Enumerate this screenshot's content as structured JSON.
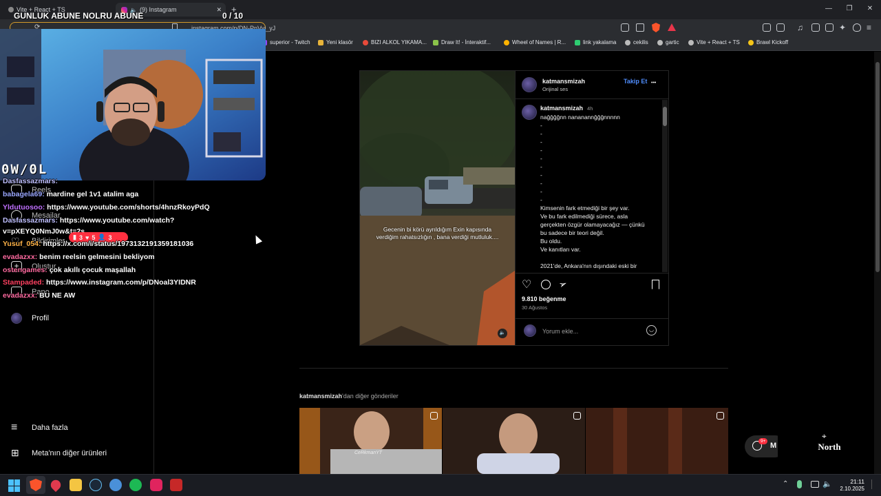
{
  "browser": {
    "tabs": [
      {
        "label": "Vite + React + TS"
      },
      {
        "label": "(9) Instagram"
      }
    ],
    "new_tab": "+",
    "url": "instagram.com/p/DN-PnVyj_yJ",
    "window_controls": [
      "—",
      "❐",
      "✕"
    ],
    "bookmarks": [
      {
        "label": "superior - Twitch",
        "color": "#9146ff"
      },
      {
        "label": "Yeni klasör",
        "color": "#e8b43a"
      },
      {
        "label": "BIZI ALKOL YIKAMA...",
        "color": "#e84a3a"
      },
      {
        "label": "Draw It! - İnteraktif...",
        "color": "#8bc34a"
      },
      {
        "label": "Wheel of Names | R...",
        "color": "#ffb300"
      },
      {
        "label": "link yakalama",
        "color": "#2ecc71"
      },
      {
        "label": "cekilis",
        "color": "#bbbbbb"
      },
      {
        "label": "gartic",
        "color": "#bbbbbb"
      },
      {
        "label": "Vite + React + TS",
        "color": "#bbbbbb"
      },
      {
        "label": "Brawl Kickoff",
        "color": "#f5c518"
      }
    ]
  },
  "overlay": {
    "goal_title": "GUNLUK ABUNE NOLRU ABUNE",
    "goal_count": "0 / 10",
    "brand": "0W/0L",
    "chat": [
      {
        "user": "Dasfassazmars:",
        "msg": "",
        "color": "#bfbfff"
      },
      {
        "user": "babagela69:",
        "msg": "mardine gel 1v1 atalim aga",
        "color": "#9aa7ff"
      },
      {
        "user": "Yldutuosoo:",
        "msg": "https://www.youtube.com/shorts/4hnzRkoyPdQ",
        "color": "#c070ff"
      },
      {
        "user": "Dasfassazmars:",
        "msg": "https://www.youtube.com/watch?",
        "color": "#bfbfff"
      },
      {
        "user": "",
        "msg": "v=pXEYQ0NmJ0w&t=2s",
        "color": "#ffffff"
      },
      {
        "user": "Yusuf_054:",
        "msg": "https://x.com/i/status/1973132191359181036",
        "color": "#ffb347"
      },
      {
        "user": "evadazxx:",
        "msg": "benim reelsin gelmesini bekliyom",
        "color": "#ff6aa0"
      },
      {
        "user": "ostengames:",
        "msg": "çok akıllı çocuk maşallah",
        "color": "#ff6aa0"
      },
      {
        "user": "Stampaded:",
        "msg": "https://www.instagram.com/p/DNoal3YIDNR",
        "color": "#ff4060"
      },
      {
        "user": "evadazxx:",
        "msg": "BU NE AW",
        "color": "#ff6aa0"
      }
    ],
    "notif": {
      "comments": "3",
      "likes": "5",
      "follows": "3"
    }
  },
  "sidebar": {
    "items": [
      {
        "label": "Reels"
      },
      {
        "label": "Mesajlar"
      },
      {
        "label": "Bildirimler"
      },
      {
        "label": "Oluştur"
      },
      {
        "label": "Pano"
      },
      {
        "label": "Profil"
      }
    ],
    "more": "Daha fazla",
    "meta": "Meta'nın diğer ürünleri"
  },
  "post": {
    "username": "katmansmizah",
    "audio": "Orijinal ses",
    "follow": "Takip Et",
    "more_dots": "•••",
    "video_caption": "Gecenin bi körü ayrıldığım Exin kapısında verdiğim rahatsızlığın , bana verdiği mutluluk....",
    "comment_user": "katmansmizah",
    "comment_time": "4h",
    "caption_lines": [
      "nağğğğnn nananannğğğnnnnn",
      "-",
      "-",
      "-",
      "-",
      "-",
      "-",
      "-",
      "-",
      "-",
      "-",
      "Kimsenin fark etmediği bir şey var.",
      "Ve bu fark edilmediği sürece, asla",
      "gerçekten özgür olamayacağız — çünkü",
      "bu sadece bir teori değil.",
      "Bu oldu.",
      "Ve kanıtları var.",
      "",
      "2021'de, Ankara'nın dışındaki eski bir"
    ],
    "likes": "9.810 beğenme",
    "date": "30 Ağustos",
    "comment_placeholder": "Yorum ekle...",
    "more_from_user": "katmansmizah",
    "more_from_suffix": "'dan diğer gönderiler"
  },
  "more_thumbs": [
    {
      "label": "CeRkmanYT"
    },
    {
      "label": ""
    },
    {
      "label": ""
    }
  ],
  "floating": {
    "badge": "9+",
    "label": "M"
  },
  "north_logo": "North",
  "taskbar": {
    "time": "21:11",
    "date": "2.10.2025"
  }
}
